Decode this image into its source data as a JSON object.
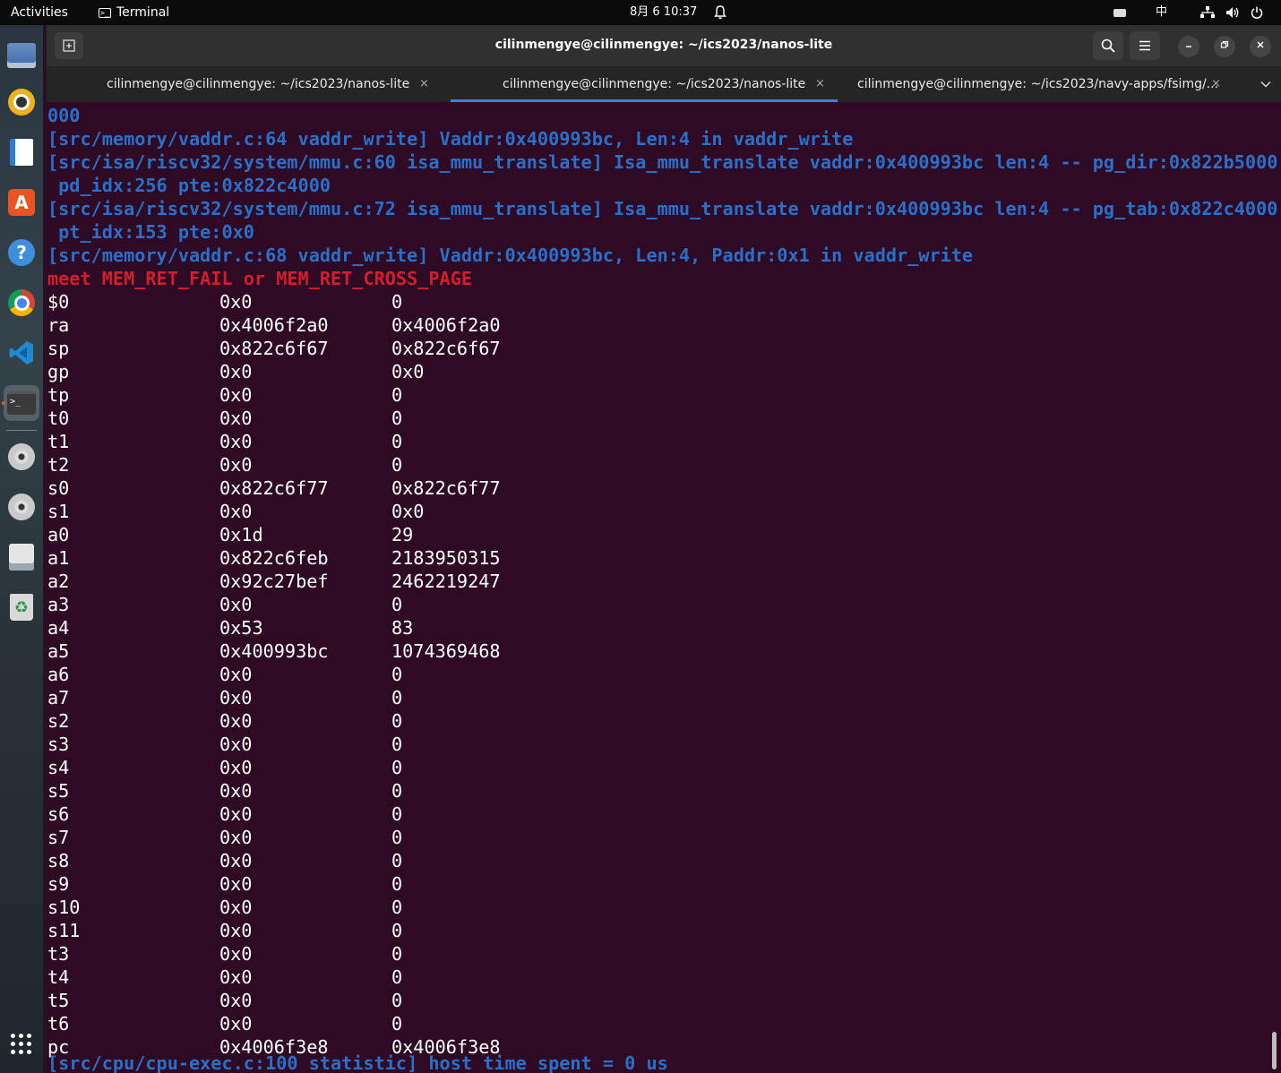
{
  "topbar": {
    "activities": "Activities",
    "app_name": "Terminal",
    "clock": "8月 6  10:37",
    "ime": "中"
  },
  "dock": {
    "items": [
      {
        "name": "files-icon"
      },
      {
        "name": "rhythmbox-icon"
      },
      {
        "name": "writer-icon"
      },
      {
        "name": "app-center-icon"
      },
      {
        "name": "help-icon"
      },
      {
        "name": "chrome-icon"
      },
      {
        "name": "vscode-icon"
      },
      {
        "name": "terminal-icon"
      },
      {
        "name": "disc-icon"
      },
      {
        "name": "disc-icon"
      },
      {
        "name": "drive-icon"
      },
      {
        "name": "trash-icon"
      }
    ],
    "accent": "#e95420"
  },
  "window": {
    "title": "cilinmengye@cilinmengye: ~/ics2023/nanos-lite",
    "tabs": [
      {
        "label": "cilinmengye@cilinmengye: ~/ics2023/nanos-lite",
        "close": "×",
        "active": false
      },
      {
        "label": "cilinmengye@cilinmengye: ~/ics2023/nanos-lite",
        "close": "×",
        "active": true
      },
      {
        "label": "cilinmengye@cilinmengye: ~/ics2023/navy-apps/fsimg/...",
        "close": "×",
        "active": false
      }
    ],
    "accent": "#3584e4"
  },
  "terminal": {
    "colors": {
      "background": "#2e0a24",
      "info": "#2a70c9",
      "error": "#d21e2d",
      "text": "#ffffff"
    },
    "log_lines": [
      {
        "text": "000",
        "style": "info"
      },
      {
        "text": "[src/memory/vaddr.c:64 vaddr_write] Vaddr:0x400993bc, Len:4 in vaddr_write",
        "style": "info"
      },
      {
        "text": "[src/isa/riscv32/system/mmu.c:60 isa_mmu_translate] Isa_mmu_translate vaddr:0x400993bc len:4 -- pg_dir:0x822b5000",
        "style": "info"
      },
      {
        "text": " pd_idx:256 pte:0x822c4000",
        "style": "info"
      },
      {
        "text": "[src/isa/riscv32/system/mmu.c:72 isa_mmu_translate] Isa_mmu_translate vaddr:0x400993bc len:4 -- pg_tab:0x822c4000",
        "style": "info"
      },
      {
        "text": " pt_idx:153 pte:0x0",
        "style": "info"
      },
      {
        "text": "[src/memory/vaddr.c:68 vaddr_write] Vaddr:0x400993bc, Len:4, Paddr:0x1 in vaddr_write",
        "style": "info"
      },
      {
        "text": "meet MEM_RET_FAIL or MEM_RET_CROSS_PAGE",
        "style": "err"
      }
    ],
    "registers": [
      {
        "name": "$0",
        "hex": "0x0",
        "value": "0"
      },
      {
        "name": "ra",
        "hex": "0x4006f2a0",
        "value": "0x4006f2a0"
      },
      {
        "name": "sp",
        "hex": "0x822c6f67",
        "value": "0x822c6f67"
      },
      {
        "name": "gp",
        "hex": "0x0",
        "value": "0x0"
      },
      {
        "name": "tp",
        "hex": "0x0",
        "value": "0"
      },
      {
        "name": "t0",
        "hex": "0x0",
        "value": "0"
      },
      {
        "name": "t1",
        "hex": "0x0",
        "value": "0"
      },
      {
        "name": "t2",
        "hex": "0x0",
        "value": "0"
      },
      {
        "name": "s0",
        "hex": "0x822c6f77",
        "value": "0x822c6f77"
      },
      {
        "name": "s1",
        "hex": "0x0",
        "value": "0x0"
      },
      {
        "name": "a0",
        "hex": "0x1d",
        "value": "29"
      },
      {
        "name": "a1",
        "hex": "0x822c6feb",
        "value": "2183950315"
      },
      {
        "name": "a2",
        "hex": "0x92c27bef",
        "value": "2462219247"
      },
      {
        "name": "a3",
        "hex": "0x0",
        "value": "0"
      },
      {
        "name": "a4",
        "hex": "0x53",
        "value": "83"
      },
      {
        "name": "a5",
        "hex": "0x400993bc",
        "value": "1074369468"
      },
      {
        "name": "a6",
        "hex": "0x0",
        "value": "0"
      },
      {
        "name": "a7",
        "hex": "0x0",
        "value": "0"
      },
      {
        "name": "s2",
        "hex": "0x0",
        "value": "0"
      },
      {
        "name": "s3",
        "hex": "0x0",
        "value": "0"
      },
      {
        "name": "s4",
        "hex": "0x0",
        "value": "0"
      },
      {
        "name": "s5",
        "hex": "0x0",
        "value": "0"
      },
      {
        "name": "s6",
        "hex": "0x0",
        "value": "0"
      },
      {
        "name": "s7",
        "hex": "0x0",
        "value": "0"
      },
      {
        "name": "s8",
        "hex": "0x0",
        "value": "0"
      },
      {
        "name": "s9",
        "hex": "0x0",
        "value": "0"
      },
      {
        "name": "s10",
        "hex": "0x0",
        "value": "0"
      },
      {
        "name": "s11",
        "hex": "0x0",
        "value": "0"
      },
      {
        "name": "t3",
        "hex": "0x0",
        "value": "0"
      },
      {
        "name": "t4",
        "hex": "0x0",
        "value": "0"
      },
      {
        "name": "t5",
        "hex": "0x0",
        "value": "0"
      },
      {
        "name": "t6",
        "hex": "0x0",
        "value": "0"
      },
      {
        "name": "pc",
        "hex": "0x4006f3e8",
        "value": "0x4006f3e8"
      }
    ],
    "trailing_line": {
      "text": "[src/cpu/cpu-exec.c:100 statistic] host time spent = 0 us",
      "style": "info"
    }
  }
}
